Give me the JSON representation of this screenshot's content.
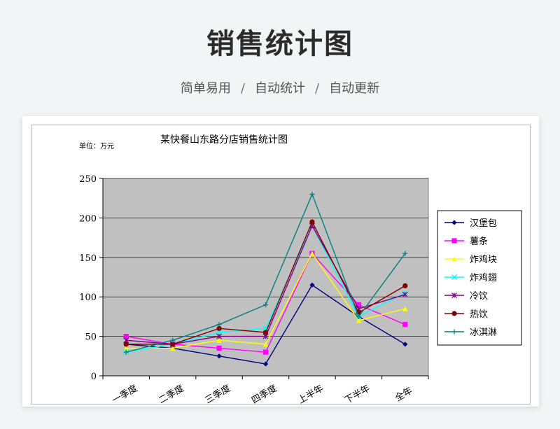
{
  "page": {
    "title": "销售统计图",
    "subtitle": [
      "简单易用",
      "自动统计",
      "自动更新"
    ],
    "subtitle_separator": "/"
  },
  "chart_data": {
    "type": "line",
    "title": "某快餐山东路分店销售统计图",
    "unit_label": "单位：万元",
    "categories": [
      "一季度",
      "二季度",
      "三季度",
      "四季度",
      "上半年",
      "下半年",
      "全年"
    ],
    "ylim": [
      0,
      250
    ],
    "yticks": [
      0,
      50,
      100,
      150,
      200,
      250
    ],
    "grid": true,
    "plot_background": "#c0c0c0",
    "legend_position": "right",
    "series": [
      {
        "name": "汉堡包",
        "color": "#000080",
        "marker": "diamond",
        "values": [
          40,
          35,
          25,
          15,
          115,
          75,
          40
        ]
      },
      {
        "name": "薯条",
        "color": "#ff00ff",
        "marker": "square",
        "values": [
          50,
          40,
          35,
          30,
          155,
          90,
          65
        ]
      },
      {
        "name": "炸鸡块",
        "color": "#ffff00",
        "marker": "triangle",
        "values": [
          35,
          35,
          45,
          40,
          155,
          70,
          85
        ]
      },
      {
        "name": "炸鸡翅",
        "color": "#00ffff",
        "marker": "x",
        "values": [
          30,
          40,
          55,
          60,
          190,
          75,
          105
        ]
      },
      {
        "name": "冷饮",
        "color": "#800080",
        "marker": "asterisk",
        "values": [
          45,
          40,
          50,
          50,
          190,
          85,
          103
        ]
      },
      {
        "name": "热饮",
        "color": "#800000",
        "marker": "circle",
        "values": [
          40,
          40,
          60,
          55,
          195,
          80,
          114
        ]
      },
      {
        "name": "冰淇淋",
        "color": "#008080",
        "marker": "plus",
        "values": [
          30,
          45,
          65,
          90,
          230,
          75,
          155
        ]
      }
    ]
  }
}
